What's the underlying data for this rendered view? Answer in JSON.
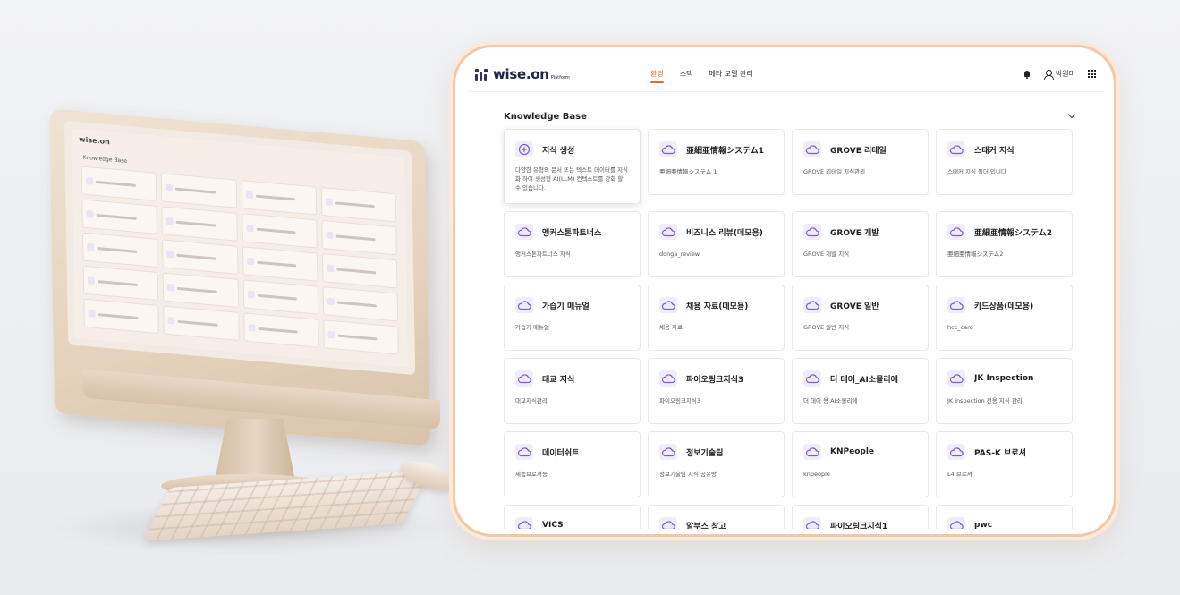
{
  "app": {
    "logo_text": "wise.on",
    "logo_sub": "Platform"
  },
  "nav": {
    "items": [
      {
        "label": "환경",
        "active": true
      },
      {
        "label": "스택",
        "active": false
      },
      {
        "label": "메타 모델 관리",
        "active": false
      }
    ]
  },
  "user": {
    "name": "박원미"
  },
  "section": {
    "title": "Knowledge Base"
  },
  "cards": [
    {
      "title": "지식 생성",
      "desc": "다양한 유형의 문서 또는 텍스트 데이터를 지식화 하여 생성형 AI(LLM) 컨텍스트를 강화 할 수 있습니다.",
      "icon": "plus-icon",
      "featured": true
    },
    {
      "title": "亜細亜情報システム1",
      "desc": "亜細亜情報システム 1",
      "icon": "cloud-icon"
    },
    {
      "title": "GROVE 리테일",
      "desc": "GROVE 리테일 지식관리",
      "icon": "cloud-icon"
    },
    {
      "title": "스태커 지식",
      "desc": "스태커 지식 폴더 입니다",
      "icon": "cloud-icon"
    },
    {
      "title": "앵커스톤파트너스",
      "desc": "앵커스톤파트너스 지식",
      "icon": "cloud-icon"
    },
    {
      "title": "비즈니스 리뷰(데모용)",
      "desc": "donga_review",
      "icon": "cloud-icon"
    },
    {
      "title": "GROVE 개발",
      "desc": "GROVE 개발 지식",
      "icon": "cloud-icon"
    },
    {
      "title": "亜細亜情報システム2",
      "desc": "亜細亜情報システム2",
      "icon": "cloud-icon"
    },
    {
      "title": "가습기 매뉴얼",
      "desc": "가습기 매뉴얼",
      "icon": "cloud-icon"
    },
    {
      "title": "채용 자료(데모용)",
      "desc": "채용 자료",
      "icon": "cloud-icon"
    },
    {
      "title": "GROVE 일반",
      "desc": "GROVE 일반 지식",
      "icon": "cloud-icon"
    },
    {
      "title": "카드상품(데모용)",
      "desc": "hcc_card",
      "icon": "cloud-icon"
    },
    {
      "title": "대교 지식",
      "desc": "대교지식관리",
      "icon": "cloud-icon"
    },
    {
      "title": "파이오링크지식3",
      "desc": "파이오링크지식3",
      "icon": "cloud-icon"
    },
    {
      "title": "더 데어_AI소몰리에",
      "desc": "더 데어 용 AI소몰리에",
      "icon": "cloud-icon"
    },
    {
      "title": "JK Inspection",
      "desc": "JK inspection 전용 지식 관리",
      "icon": "cloud-icon"
    },
    {
      "title": "데이터쉬트",
      "desc": "제품브로셔등",
      "icon": "cloud-icon"
    },
    {
      "title": "정보기술팀",
      "desc": "정보기술팀 지식 공유방",
      "icon": "cloud-icon"
    },
    {
      "title": "KNPeople",
      "desc": "knpeople",
      "icon": "cloud-icon"
    },
    {
      "title": "PAS-K 브로셔",
      "desc": "L4 브로셔",
      "icon": "cloud-icon"
    },
    {
      "title": "VICS",
      "desc": "",
      "icon": "cloud-icon"
    },
    {
      "title": "알부스 창고",
      "desc": "",
      "icon": "cloud-icon"
    },
    {
      "title": "파이오링크지식1",
      "desc": "",
      "icon": "cloud-icon"
    },
    {
      "title": "pwc",
      "desc": "",
      "icon": "cloud-icon"
    }
  ],
  "colors": {
    "accent": "#e8673b",
    "icon_bg": "#f1ecfb",
    "icon_stroke": "#7b5cc8",
    "frame_border": "#f2c8a6"
  },
  "illustration": {
    "mini_logo": "wise.on",
    "mini_title": "Knowledge Base"
  }
}
